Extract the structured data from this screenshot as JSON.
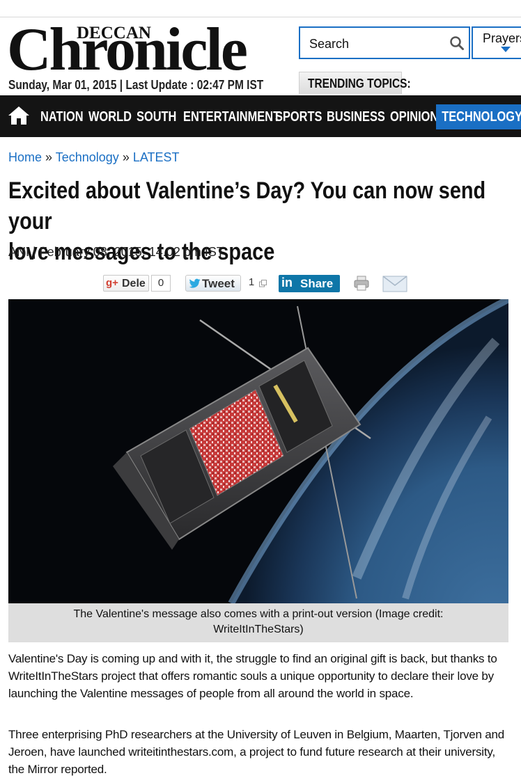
{
  "masthead": {
    "logo_top": "DECCAN",
    "logo_main": "Chronicle",
    "dateline": "Sunday, Mar 01, 2015 | Last Update : 02:47 PM IST"
  },
  "search": {
    "label": "Search",
    "icon": "search-icon"
  },
  "prayers": {
    "label": "Prayers"
  },
  "trending": {
    "label": "TRENDING TOPICS:"
  },
  "nav": {
    "home_icon": "home-icon",
    "items": [
      "NATION",
      "WORLD",
      "SOUTH",
      "ENTERTAINMENT",
      "SPORTS",
      "BUSINESS",
      "OPINION",
      "TECHNOLOGY"
    ],
    "active": "TECHNOLOGY",
    "active_color": "#1a6fc4"
  },
  "breadcrumb": {
    "home": "Home",
    "sep": "»",
    "section": "Technology",
    "subsection": "LATEST"
  },
  "article": {
    "headline_line1": "Excited about Valentine’s Day? You can now send your",
    "headline_line2": "love messages to the space",
    "byline": "ANI | February 08, 2015, 14.02 pm IST",
    "caption_line1": "The Valentine's message also comes with a print-out version (Image credit:",
    "caption_line2": "WriteItInTheStars)",
    "para1": "Valentine's Day is coming up and with it, the struggle to find an original gift is back, but thanks to WriteItInTheStars project that offers romantic souls a unique opportunity to declare their love by launching the Valentine messages of people from all around the world in space.",
    "para2": "Three enterprising PhD researchers at the University of Leuven in Belgium, Maarten, Tjorven and Jeroen, have launched writeitinthestars.com, a project to fund future research at their university, the Mirror reported."
  },
  "share": {
    "gplus_mark": "g+",
    "gplus_label": "Dele",
    "gplus_count": "0",
    "tweet_label": "Tweet",
    "tweet_count": "1",
    "linkedin_mark": "in",
    "linkedin_label": "Share",
    "print_icon": "print-icon",
    "mail_icon": "mail-icon"
  }
}
